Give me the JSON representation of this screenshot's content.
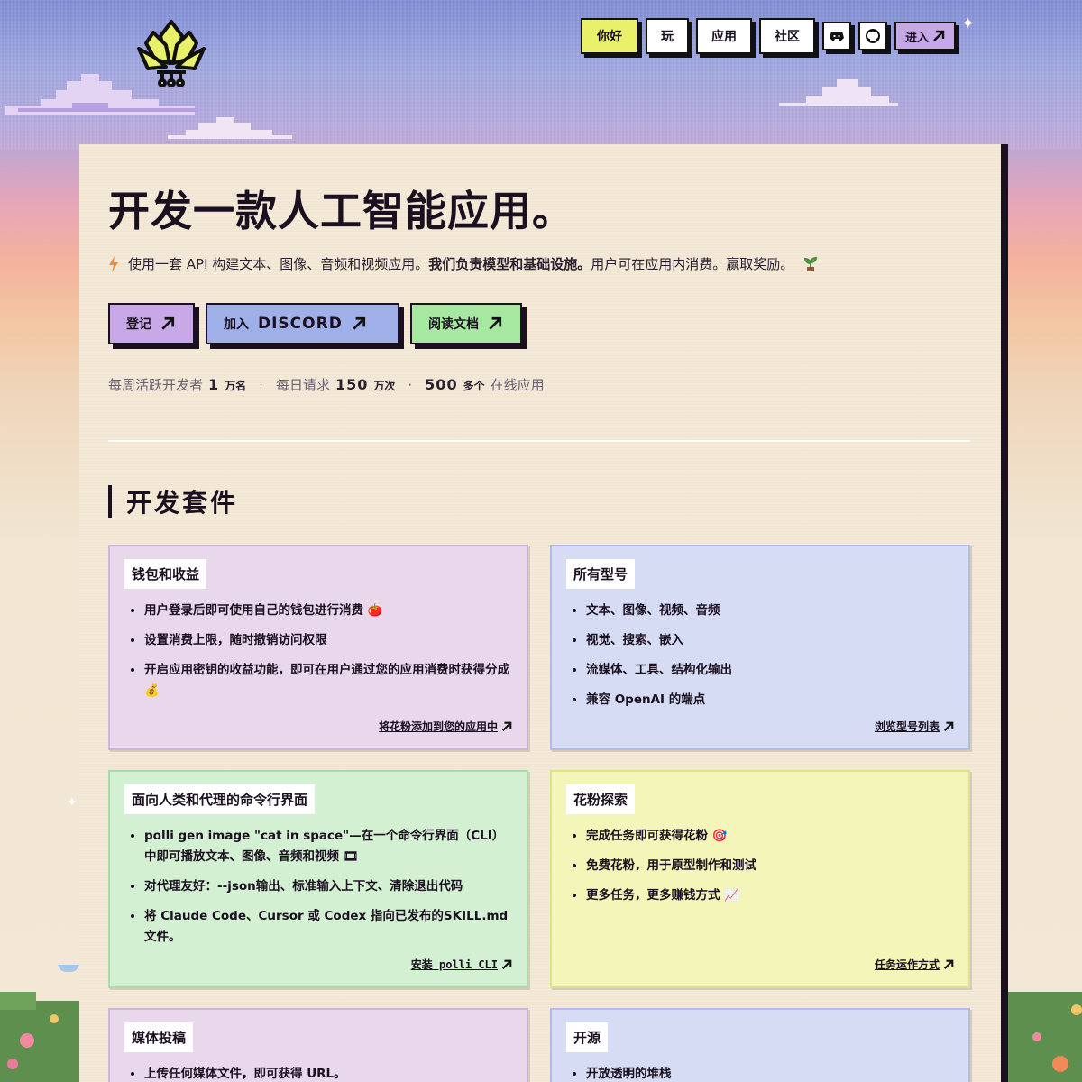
{
  "nav": {
    "items": [
      {
        "label": "你好",
        "active": true
      },
      {
        "label": "玩"
      },
      {
        "label": "应用"
      },
      {
        "label": "社区"
      }
    ],
    "icons": [
      "discord-icon",
      "github-icon"
    ],
    "enter_label": "进入"
  },
  "hero": {
    "title": "开发一款人工智能应用。",
    "subtitle_pre": "使用一套 API 构建文本、图像、音频和视频应用。",
    "subtitle_bold": "我们负责模型和基础设施。",
    "subtitle_post": "用户可在应用内消费。赢取奖励。"
  },
  "cta": {
    "signin": "登记",
    "discord_pre": "加入",
    "discord_brand": "DISCORD",
    "docs": "阅读文档"
  },
  "stats": {
    "devs_label": "每周活跃开发者",
    "devs_num": "1",
    "devs_unit": "万名",
    "req_label": "每日请求",
    "req_num": "150",
    "req_unit": "万次",
    "apps_num": "500",
    "apps_unit": "多个",
    "apps_label": "在线应用",
    "sep": "·"
  },
  "section": {
    "title": "开发套件"
  },
  "cards": [
    {
      "title": "钱包和收益",
      "items": [
        "用户登录后即可使用自己的钱包进行消费 🍅",
        "设置消费上限，随时撤销访问权限",
        "开启应用密钥的收益功能，即可在用户通过您的应用消费时获得分成 💰"
      ],
      "link": "将花粉添加到您的应用中"
    },
    {
      "title": "所有型号",
      "items": [
        "文本、图像、视频、音频",
        "视觉、搜索、嵌入",
        "流媒体、工具、结构化输出",
        "兼容 OpenAI 的端点"
      ],
      "link": "浏览型号列表"
    },
    {
      "title": "面向人类和代理的命令行界面",
      "items": [
        "polli gen image \"cat in space\"—在一个命令行界面（CLI）中即可播放文本、图像、音频和视频 🎞",
        "对代理友好：--json输出、标准输入上下文、清除退出代码",
        "将 Claude Code、Cursor 或 Codex 指向已发布的SKILL.md文件。"
      ],
      "link": "安装 polli CLI"
    },
    {
      "title": "花粉探索",
      "items": [
        "完成任务即可获得花粉 🎯",
        "免费花粉，用于原型制作和测试",
        "更多任务，更多赚钱方式 📈"
      ],
      "link": "任务运作方式"
    },
    {
      "title": "媒体投稿",
      "items": [
        "上传任何媒体文件，即可获得 URL。"
      ]
    },
    {
      "title": "开源",
      "items": [
        "开放透明的堆栈"
      ]
    }
  ],
  "colors": {
    "accent_yellow": "#e9f06a",
    "purple": "#c9a8e8",
    "blue": "#9fb0e8",
    "green": "#a6e8a0",
    "ink": "#1a1020"
  }
}
